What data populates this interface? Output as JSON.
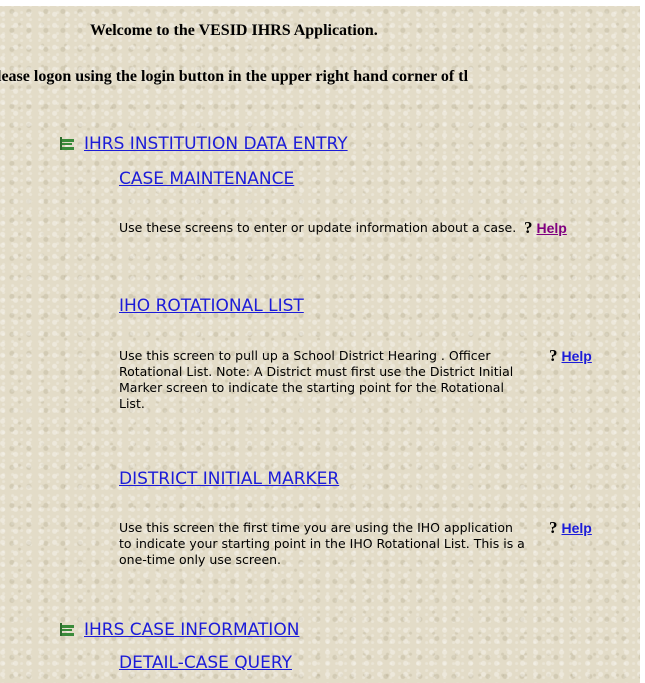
{
  "welcome_text": "Welcome to the VESID IHRS Application.",
  "logon_text": "lease logon using the login button in the upper right hand corner of tl",
  "sections": [
    {
      "title": "IHRS INSTITUTION DATA ENTRY",
      "items": [
        {
          "label": "CASE MAINTENANCE",
          "description": "Use these screens to enter or update information about a case.",
          "help_mark": "?",
          "help_label": "Help"
        },
        {
          "label": "IHO ROTATIONAL LIST",
          "description": "Use this screen to pull up a School District Hearing . Officer Rotational List.  Note: A District must first use the District Initial Marker screen to indicate the starting point for the Rotational List.",
          "help_mark": "?",
          "help_label": "Help"
        },
        {
          "label": "DISTRICT INITIAL MARKER",
          "description": "Use this screen the first time you are using the IHO application to indicate your starting point in the IHO Rotational List.  This is a one-time only use screen.",
          "help_mark": "?",
          "help_label": "Help"
        }
      ]
    },
    {
      "title": "IHRS CASE INFORMATION",
      "items": [
        {
          "label": "DETAIL-CASE QUERY"
        }
      ]
    }
  ],
  "colors": {
    "link": "#1c1cd8",
    "visited_link": "#800080",
    "background": "#e3dcc8"
  },
  "icons": {
    "section": "tree-node-icon"
  }
}
